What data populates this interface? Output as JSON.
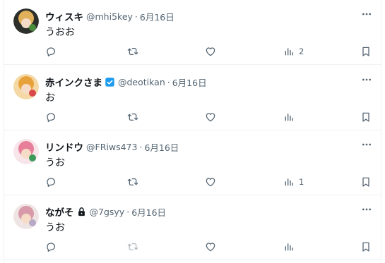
{
  "tweets": [
    {
      "name": "ウィスキ",
      "handle": "@mhi5key",
      "date": "6月16日",
      "text": "うおお",
      "verified": false,
      "locked": false,
      "views": "2",
      "retweet_muted": false,
      "avatar_colors": [
        "#2c2f2a",
        "#e0b05a",
        "#4a8d3a"
      ]
    },
    {
      "name": "赤インクさま",
      "handle": "@deotikan",
      "date": "6月16日",
      "text": "お",
      "verified": true,
      "locked": false,
      "views": "",
      "retweet_muted": false,
      "avatar_colors": [
        "#f4d9a6",
        "#e8a23c",
        "#d9484a"
      ]
    },
    {
      "name": "リンドウ",
      "handle": "@FRiws473",
      "date": "6月16日",
      "text": "うお",
      "verified": false,
      "locked": false,
      "views": "1",
      "retweet_muted": false,
      "avatar_colors": [
        "#f7e5ea",
        "#e77f9a",
        "#3b9a5a"
      ]
    },
    {
      "name": "ながそ",
      "handle": "@7gsyy",
      "date": "6月16日",
      "text": "うお",
      "verified": false,
      "locked": true,
      "views": "",
      "retweet_muted": true,
      "avatar_colors": [
        "#efe4e4",
        "#d89aa8",
        "#b6a8c6"
      ]
    }
  ],
  "separator": "·",
  "icons": {
    "more": "more-horizontal-icon",
    "reply": "reply-icon",
    "retweet": "retweet-icon",
    "like": "heart-icon",
    "views": "analytics-icon",
    "bookmark": "bookmark-icon",
    "verified": "verified-badge-icon",
    "locked": "lock-icon"
  },
  "colors": {
    "text": "#0f1419",
    "secondary": "#536471",
    "verified": "#1d9bf0",
    "border": "#eff3f4"
  }
}
